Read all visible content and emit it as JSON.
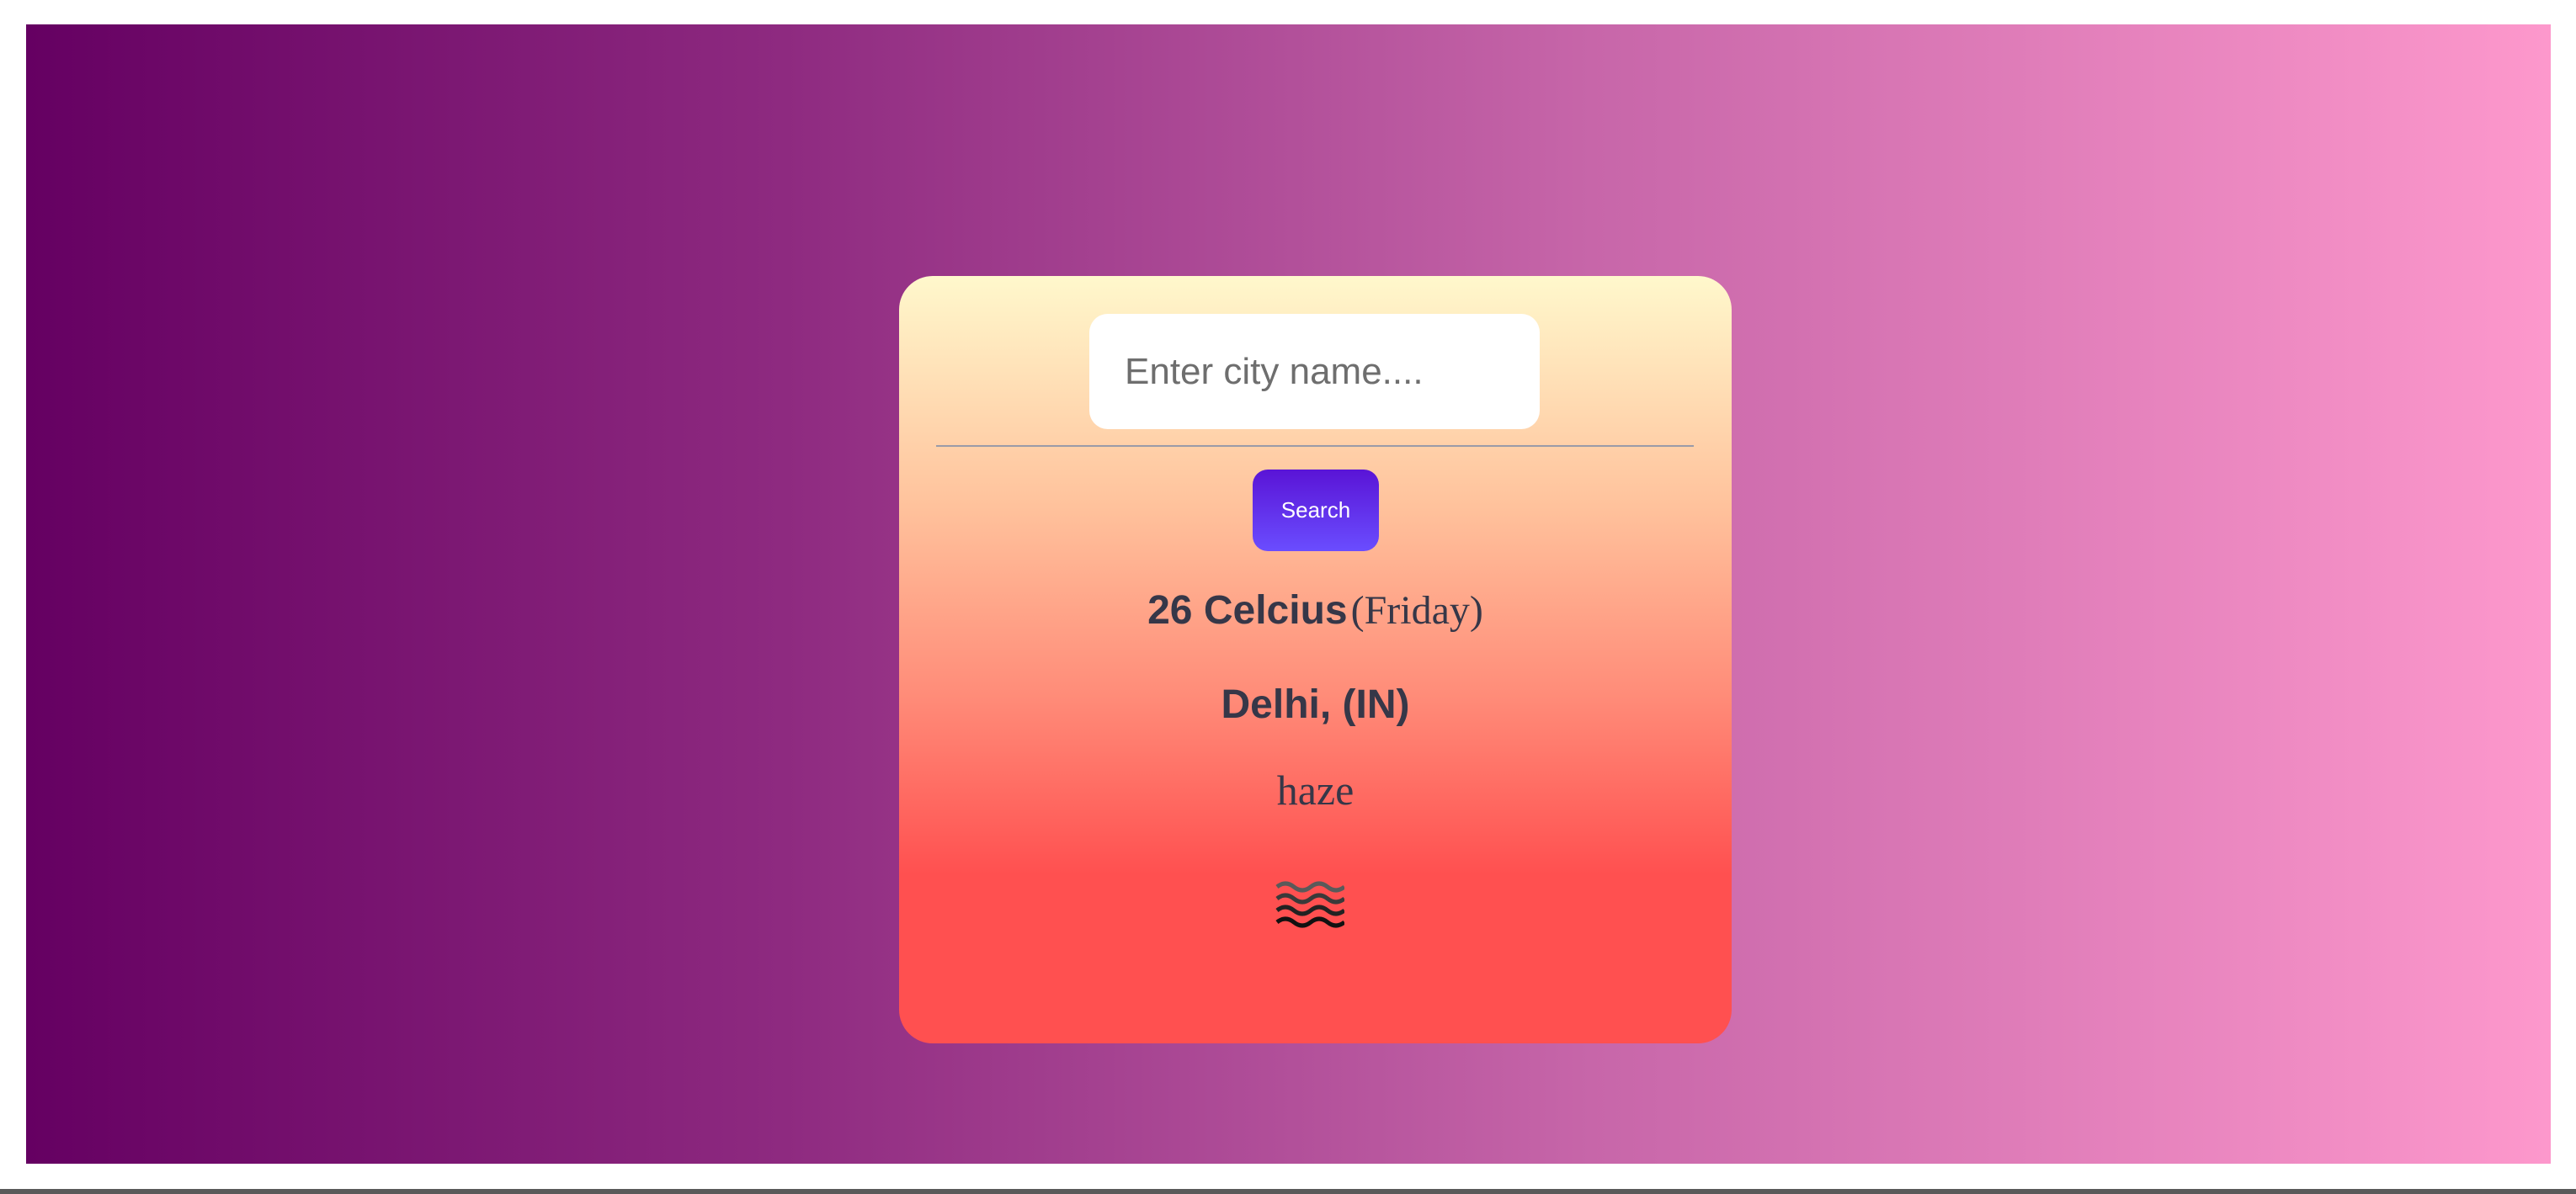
{
  "search": {
    "placeholder": "Enter city name....",
    "value": "",
    "button_label": "Search"
  },
  "weather": {
    "temperature": "26 Celcius",
    "day": "(Friday)",
    "location": "Delhi, (IN)",
    "condition": "haze",
    "icon": "haze-icon"
  },
  "colors": {
    "background_start": "#650062",
    "background_end": "#fd98cc",
    "card_top": "#fff8cc",
    "card_bottom": "#ff5050",
    "button_start": "#5a14d6",
    "button_end": "#6a4dff",
    "text": "#363748"
  }
}
